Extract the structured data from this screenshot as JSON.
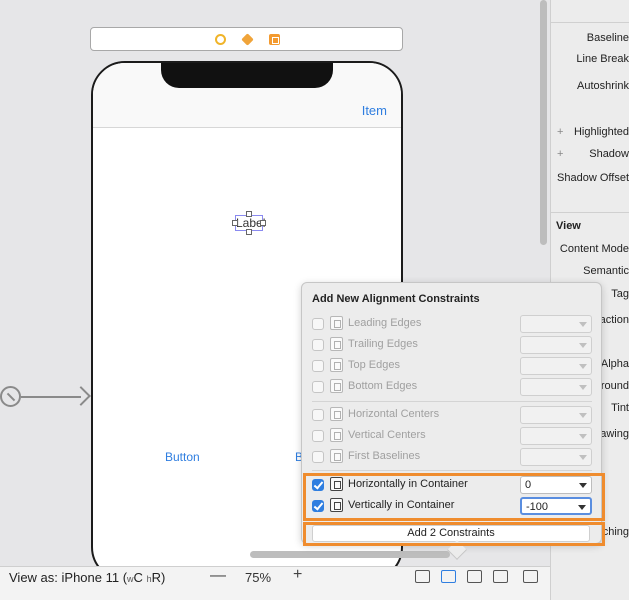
{
  "canvas": {
    "navbar_item": "Item",
    "label_text": "Label",
    "button_left": "Button",
    "button_right": "B"
  },
  "bottombar": {
    "view_as_prefix": "View as: iPhone 11 (",
    "size_w": "w",
    "size_w_val": "C",
    "size_h": "h",
    "size_h_val": "R",
    "view_as_suffix": ")",
    "zoom_minus": "—",
    "zoom": "75%",
    "zoom_plus": "+"
  },
  "inspector": {
    "rows": [
      "Baseline",
      "Line Break",
      "Autoshrink",
      "Highlighted",
      "Shadow",
      "Shadow Offset"
    ],
    "plus": "+",
    "view_section": "View",
    "view_rows": [
      "Content Mode",
      "Semantic",
      "Tag",
      "Interaction",
      "Alpha",
      "Background",
      "Tint",
      "Drawing",
      "Stretching"
    ]
  },
  "popover": {
    "title": "Add New Alignment Constraints",
    "disabled_items": [
      {
        "label": "Leading Edges"
      },
      {
        "label": "Trailing Edges"
      },
      {
        "label": "Top Edges"
      },
      {
        "label": "Bottom Edges"
      },
      {
        "label": "Horizontal Centers"
      },
      {
        "label": "Vertical Centers"
      },
      {
        "label": "First Baselines"
      }
    ],
    "enabled_items": [
      {
        "label": "Horizontally in Container",
        "value": "0",
        "checked": true
      },
      {
        "label": "Vertically in Container",
        "value": "-100",
        "checked": true
      }
    ],
    "add_button": "Add 2 Constraints"
  },
  "colors": {
    "accent_blue": "#2f7ee0",
    "highlight_orange": "#ef8c2e"
  }
}
